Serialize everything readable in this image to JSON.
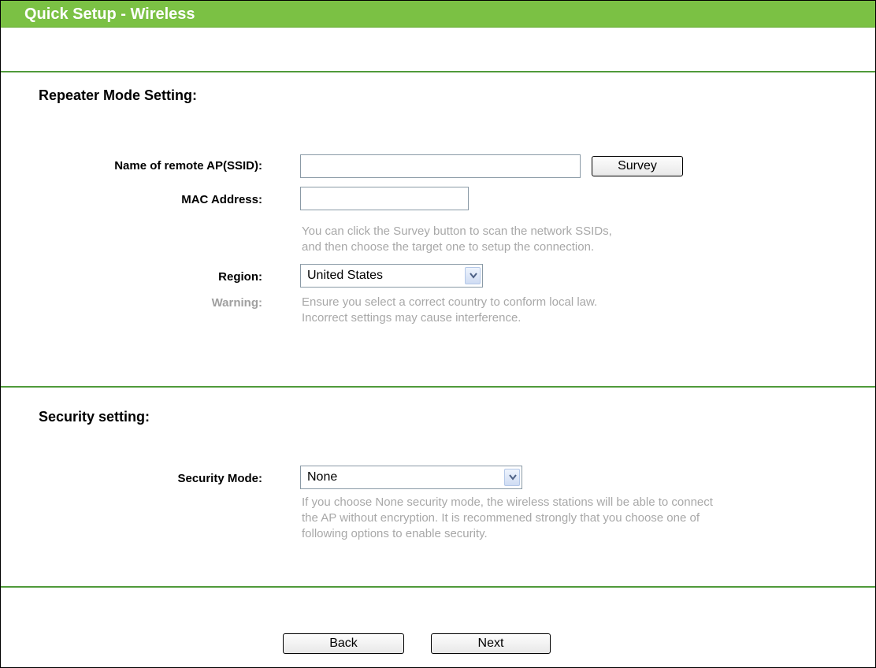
{
  "header": {
    "title": "Quick Setup - Wireless"
  },
  "repeater": {
    "title": "Repeater Mode Setting:",
    "ssid_label": "Name of remote AP(SSID):",
    "ssid_value": "",
    "survey_label": "Survey",
    "mac_label": "MAC Address:",
    "mac_value": "",
    "hint_line1": "You can click the Survey button to scan the network SSIDs,",
    "hint_line2": "and then choose the target one to setup the connection.",
    "region_label": "Region:",
    "region_value": "United States",
    "warning_label": "Warning:",
    "warning_line1": "Ensure you select a correct country to conform local law.",
    "warning_line2": "Incorrect settings may cause interference."
  },
  "security": {
    "title": "Security setting:",
    "mode_label": "Security Mode:",
    "mode_value": "None",
    "hint_line1": "If you choose None security mode, the wireless stations will be able to connect",
    "hint_line2": "the AP without encryption. It is recommened strongly that you choose one of",
    "hint_line3": "following options to enable security."
  },
  "footer": {
    "back_label": "Back",
    "next_label": "Next"
  },
  "colors": {
    "header_bg": "#7bc144",
    "rule": "#4f9a3a",
    "hint_text": "#a8a8a8"
  },
  "icons": {
    "dropdown": "chevron-down-icon"
  }
}
